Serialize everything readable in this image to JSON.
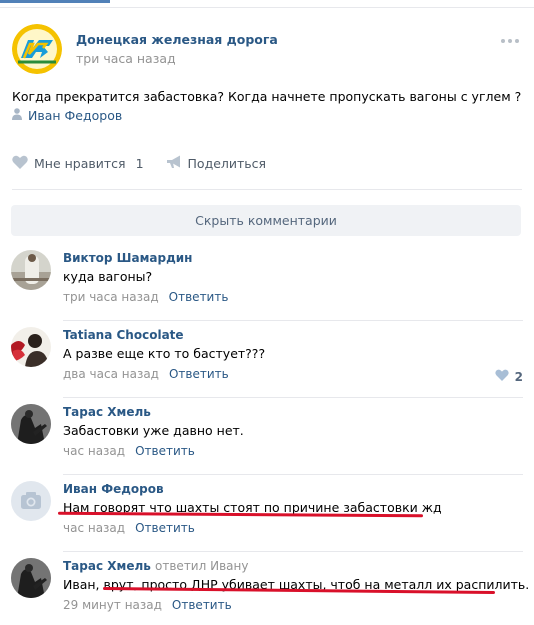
{
  "post": {
    "author": "Донецкая железная дорога",
    "time": "три часа назад",
    "text": "Когда прекратится забастовка? Когда начнете пропускать вагоны с углем ?",
    "signer": "Иван Федоров"
  },
  "actions": {
    "like_label": "Мне нравится",
    "like_count": "1",
    "share_label": "Поделиться"
  },
  "hide_comments_label": "Скрыть комментарии",
  "comments": [
    {
      "name": "Виктор Шамардин",
      "text": "куда вагоны?",
      "time": "три часа назад",
      "reply": "Ответить"
    },
    {
      "name": "Tatiana Chocolate",
      "text": "А разве еще кто то бастует???",
      "time": "два часа назад",
      "reply": "Ответить",
      "likes": "2"
    },
    {
      "name": "Тарас Хмель",
      "text": "Забастовки уже давно нет.",
      "time": "час назад",
      "reply": "Ответить"
    },
    {
      "name": "Иван Федоров",
      "text": "Нам говорят что шахты стоят по причине забастовки жд",
      "time": "час назад",
      "reply": "Ответить"
    },
    {
      "name": "Тарас Хмель",
      "replied_to": "ответил Ивану",
      "text": "Иван, врут, просто ДНР убивает шахты, чтоб на металл их распилить.",
      "time": "29 минут назад",
      "reply": "Ответить"
    }
  ],
  "colors": {
    "link": "#2a5885",
    "muted": "#939393",
    "underline": "#d9102a"
  }
}
